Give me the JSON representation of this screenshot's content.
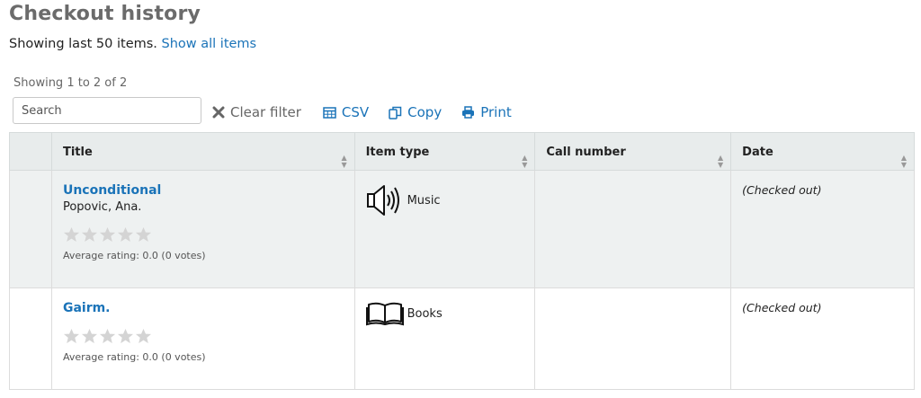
{
  "page": {
    "title": "Checkout history",
    "showing_text": "Showing last 50 items.",
    "show_all_link": "Show all items"
  },
  "table_info": "Showing 1 to 2 of 2",
  "search": {
    "placeholder": "Search"
  },
  "toolbar": {
    "clear_filter": "Clear filter",
    "csv": "CSV",
    "copy": "Copy",
    "print": "Print"
  },
  "columns": {
    "title": "Title",
    "item_type": "Item type",
    "call_number": "Call number",
    "date": "Date"
  },
  "rows": [
    {
      "title": "Unconditional",
      "author": "Popovic, Ana.",
      "stars_filled": 0,
      "stars_total": 5,
      "rating": "Average rating: 0.0 (0 votes)",
      "item_type_icon": "speaker-icon",
      "item_type": "Music",
      "call_number": "",
      "date": "(Checked out)"
    },
    {
      "title": "Gairm.",
      "author": "",
      "stars_filled": 0,
      "stars_total": 5,
      "rating": "Average rating: 0.0 (0 votes)",
      "item_type_icon": "book-icon",
      "item_type": "Books",
      "call_number": "",
      "date": "(Checked out)"
    }
  ],
  "colors": {
    "link": "#1a73b8",
    "title_gray": "#6b6b6b",
    "header_bg": "#e8ecec",
    "odd_row_bg": "#eef1f1",
    "star_empty": "#d4d4d4"
  }
}
